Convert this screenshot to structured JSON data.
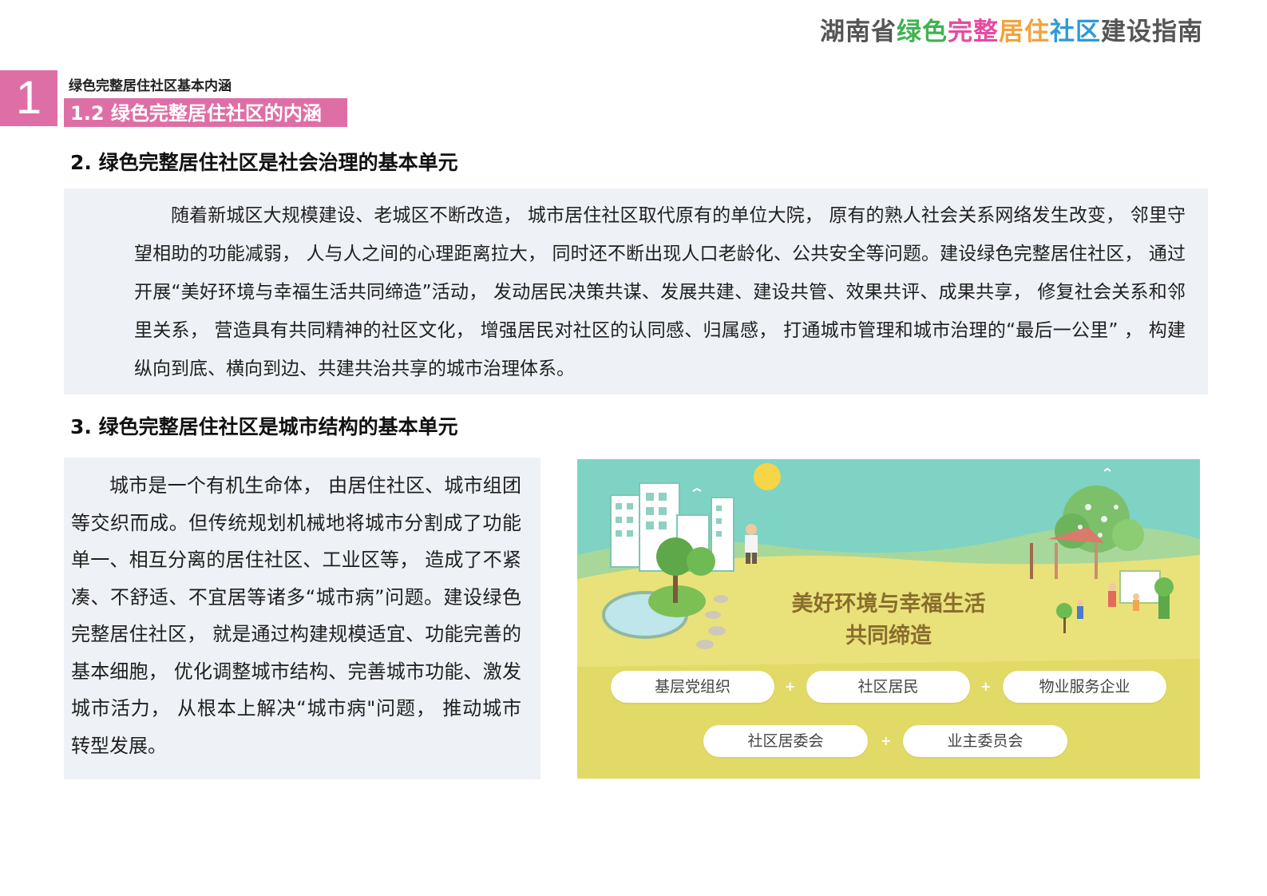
{
  "header": {
    "title_parts": [
      {
        "text": "湖南省",
        "color": "#555555"
      },
      {
        "text": "绿色",
        "color": "#3fb34f"
      },
      {
        "text": "完整",
        "color": "#e64aa0"
      },
      {
        "text": "居住",
        "color": "#f4a23c"
      },
      {
        "text": "社区",
        "color": "#2f9ad6"
      },
      {
        "text": "建设指南",
        "color": "#555555"
      }
    ]
  },
  "chapter": {
    "number": "1",
    "name": "绿色完整居住社区基本内涵",
    "section": "1.2 绿色完整居住社区的内涵",
    "accent_color": "#de6fa6"
  },
  "sections": [
    {
      "heading": "2. 绿色完整居住社区是社会治理的基本单元",
      "body": "随着新城区大规模建设、老城区不断改造， 城市居住社区取代原有的单位大院， 原有的熟人社会关系网络发生改变， 邻里守望相助的功能减弱， 人与人之间的心理距离拉大， 同时还不断出现人口老龄化、公共安全等问题。建设绿色完整居住社区， 通过开展“美好环境与幸福生活共同缔造”活动， 发动居民决策共谋、发展共建、建设共管、效果共评、成果共享， 修复社会关系和邻里关系， 营造具有共同精神的社区文化， 增强居民对社区的认同感、归属感， 打通城市管理和城市治理的“最后一公里” ， 构建纵向到底、横向到边、共建共治共享的城市治理体系。"
    },
    {
      "heading": "3. 绿色完整居住社区是城市结构的基本单元",
      "body": "城市是一个有机生命体， 由居住社区、城市组团等交织而成。但传统规划机械地将城市分割成了功能单一、相互分离的居住社区、工业区等， 造成了不紧凑、不舒适、不宜居等诸多“城市病”问题。建设绿色完整居住社区， 就是通过构建规模适宜、功能完善的基本细胞， 优化调整城市结构、完善城市功能、激发城市活力， 从根本上解决“城市病\"问题， 推动城市转型发展。"
    }
  ],
  "illustration": {
    "title_line1": "美好环境与幸福生活",
    "title_line2": "共同缔造",
    "plus": "+",
    "pills_row1": [
      "基层党组织",
      "社区居民",
      "物业服务企业"
    ],
    "pills_row2": [
      "社区居委会",
      "业主委员会"
    ]
  }
}
